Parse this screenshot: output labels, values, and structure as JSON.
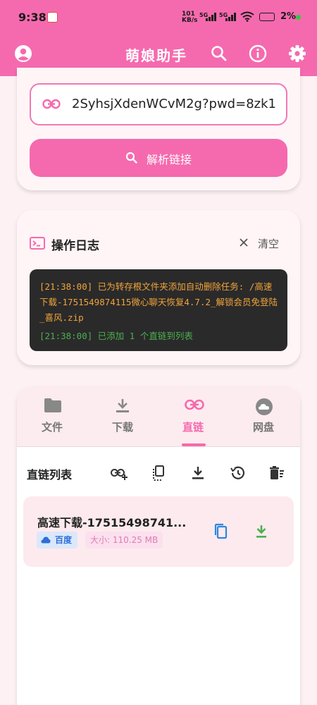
{
  "status_bar": {
    "time": "9:38",
    "net_speed_value": "101",
    "net_speed_unit": "KB/s",
    "sig1": "5G",
    "sig2": "5G",
    "battery": "2%"
  },
  "header": {
    "title": "萌娘助手",
    "icons": [
      "account-icon",
      "search-icon",
      "info-icon",
      "settings-icon"
    ]
  },
  "parse_card": {
    "url_value": "2SyhsjXdenWCvM2g?pwd=8zk1",
    "parse_button": "解析链接"
  },
  "log_card": {
    "title": "操作日志",
    "clear_label": "清空",
    "entries": [
      "[21:38:00] 已为转存根文件夹添加自动删除任务: /高速下载-1751549874115微心聊天恢复4.7.2_解锁会员免登陆_喜风.zip",
      "[21:38:00] 已添加 1 个直链到列表"
    ]
  },
  "tabs": [
    {
      "label": "文件",
      "icon": "folder-icon",
      "active": false
    },
    {
      "label": "下载",
      "icon": "download-icon",
      "active": false
    },
    {
      "label": "直链",
      "icon": "link-icon",
      "active": true
    },
    {
      "label": "网盘",
      "icon": "cloud-icon",
      "active": false
    }
  ],
  "direct_links": {
    "title": "直链列表",
    "toolbar_icons": [
      "add-link-icon",
      "copy-all-icon",
      "download-all-icon",
      "history-icon",
      "clear-list-icon"
    ],
    "items": [
      {
        "name": "高速下载-17515498741...",
        "source": "百度",
        "size": "大小: 110.25 MB"
      }
    ]
  },
  "colors": {
    "primary": "#f56aae",
    "background": "#fdf1f3",
    "log_bg": "#2a2a2a",
    "log_warn": "#f2a33a",
    "log_ok": "#4caf50",
    "copy_blue": "#2e86de",
    "download_green": "#4caf50"
  }
}
